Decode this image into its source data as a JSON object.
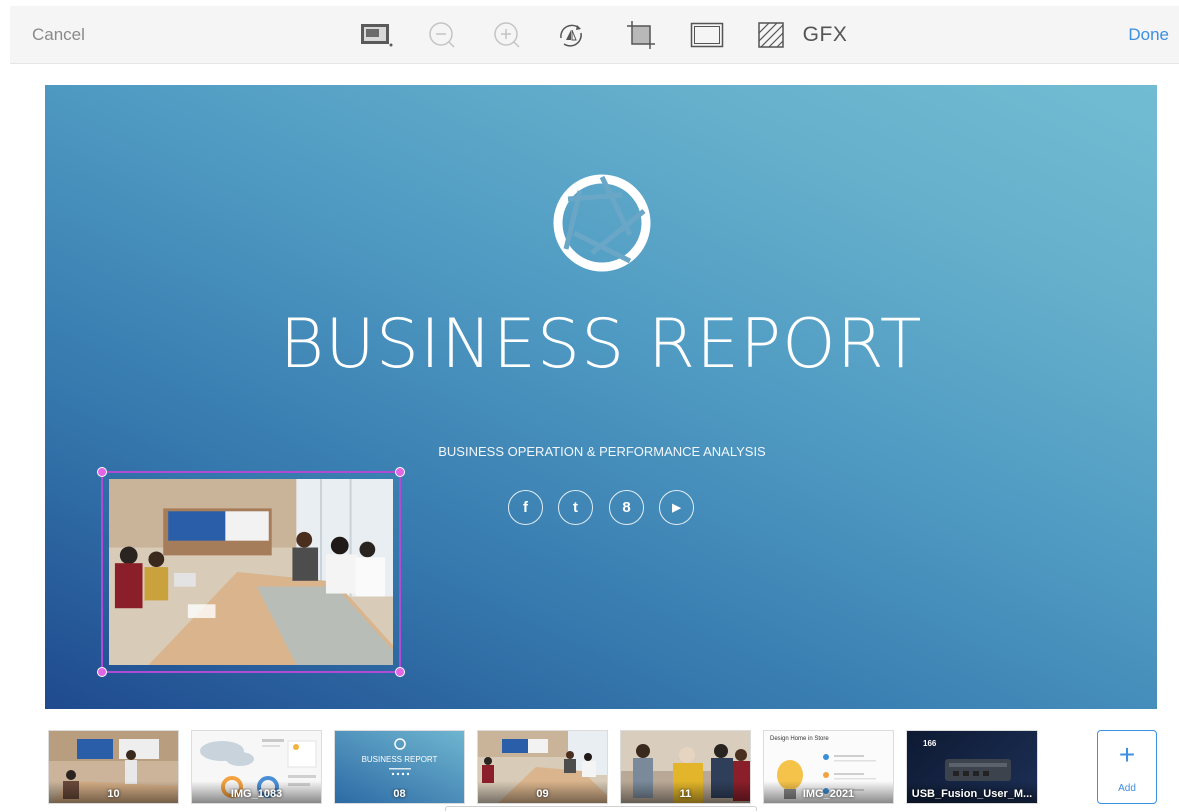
{
  "toolbar": {
    "cancel_label": "Cancel",
    "done_label": "Done",
    "gfx_label": "GFX",
    "tools": [
      "slide-layout-icon",
      "zoom-out-icon",
      "zoom-in-icon",
      "rotate-icon",
      "crop-icon",
      "frame-icon",
      "fill-pattern-icon"
    ]
  },
  "slide": {
    "title": "BUSINESS REPORT",
    "subtitle": "BUSINESS OPERATION & PERFORMANCE ANALYSIS",
    "social_icons": [
      "facebook-icon",
      "twitter-icon",
      "google-plus-icon",
      "youtube-icon"
    ],
    "social_glyphs": [
      "f",
      "t",
      "8",
      "▶"
    ],
    "colors": {
      "gradient_dark": "#1f4a8e",
      "gradient_light": "#72bcd3",
      "selection": "#b04bd6"
    }
  },
  "filmstrip": {
    "thumbnails": [
      {
        "label": "10"
      },
      {
        "label": "IMG_1083"
      },
      {
        "label": "08"
      },
      {
        "label": "09"
      },
      {
        "label": "11"
      },
      {
        "label": "IMG_2021"
      },
      {
        "label": "USB_Fusion_User_M..."
      }
    ],
    "thumb_text": {
      "report_title": "BUSINESS REPORT",
      "design_title": "Design Home in Store",
      "dark_number": "166"
    },
    "add_label": "Add",
    "add_symbol": "+"
  }
}
